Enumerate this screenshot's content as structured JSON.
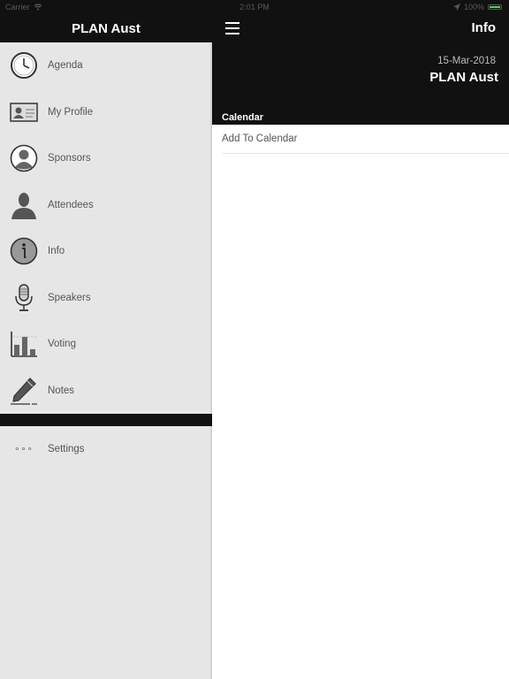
{
  "status_bar": {
    "carrier": "Carrier",
    "time": "2:01 PM",
    "battery": "100%",
    "wifi_icon": "wifi-icon",
    "location_icon": "location-arrow-icon",
    "battery_color": "#4cd964"
  },
  "drawer": {
    "title": "PLAN Aust",
    "items": [
      {
        "label": "Agenda",
        "icon": "clock-icon"
      },
      {
        "label": "My Profile",
        "icon": "profile-card-icon"
      },
      {
        "label": "Sponsors",
        "icon": "sponsor-person-icon"
      },
      {
        "label": "Attendees",
        "icon": "attendee-person-icon"
      },
      {
        "label": "Info",
        "icon": "info-icon"
      },
      {
        "label": "Speakers",
        "icon": "microphone-icon"
      },
      {
        "label": "Voting",
        "icon": "bar-chart-icon"
      },
      {
        "label": "Notes",
        "icon": "pen-icon"
      }
    ],
    "settings": {
      "label": "Settings",
      "dots": "∘∘∘",
      "icon": "more-dots-icon"
    }
  },
  "main": {
    "title": "Info",
    "header": {
      "date": "15-Mar-2018",
      "name": "PLAN Aust"
    },
    "section_title": "Calendar",
    "rows": [
      {
        "label": "Add To Calendar"
      }
    ]
  }
}
